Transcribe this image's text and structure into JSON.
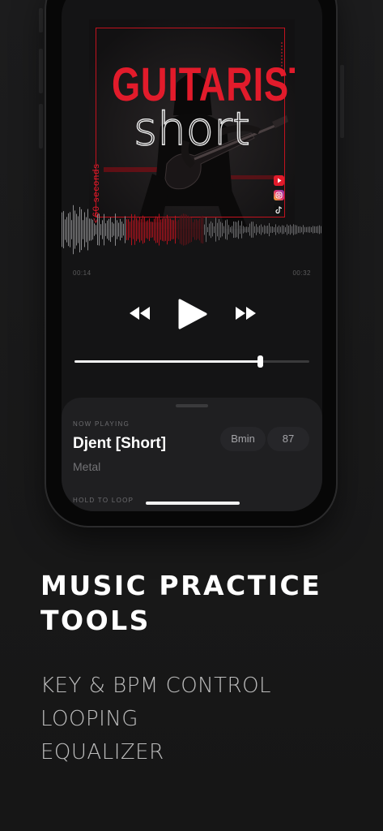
{
  "cover": {
    "title": "GUITARIST",
    "subtitle": "short",
    "side_text": "<60 seconds",
    "social_icons": [
      "youtube-icon",
      "instagram-icon",
      "tiktok-icon"
    ]
  },
  "player": {
    "elapsed": "00:14",
    "total": "00:32",
    "progress": 0.79,
    "controls": [
      "rewind-icon",
      "play-icon",
      "fast-forward-icon"
    ]
  },
  "now_playing": {
    "label": "NOW PLAYING",
    "title": "Djent [Short]",
    "genre": "Metal",
    "key": "Bmin",
    "bpm": "87",
    "hold_label": "HOLD TO LOOP"
  },
  "marketing": {
    "headline_lines": [
      "MUSIC PRACTICE",
      "TOOLS"
    ],
    "features": [
      "KEY & BPM CONTROL",
      "LOOPING",
      "EQUALIZER"
    ]
  },
  "colors": {
    "accent": "#e21b2b",
    "background": "#1a1a1a",
    "sheet": "#1f1f21"
  }
}
